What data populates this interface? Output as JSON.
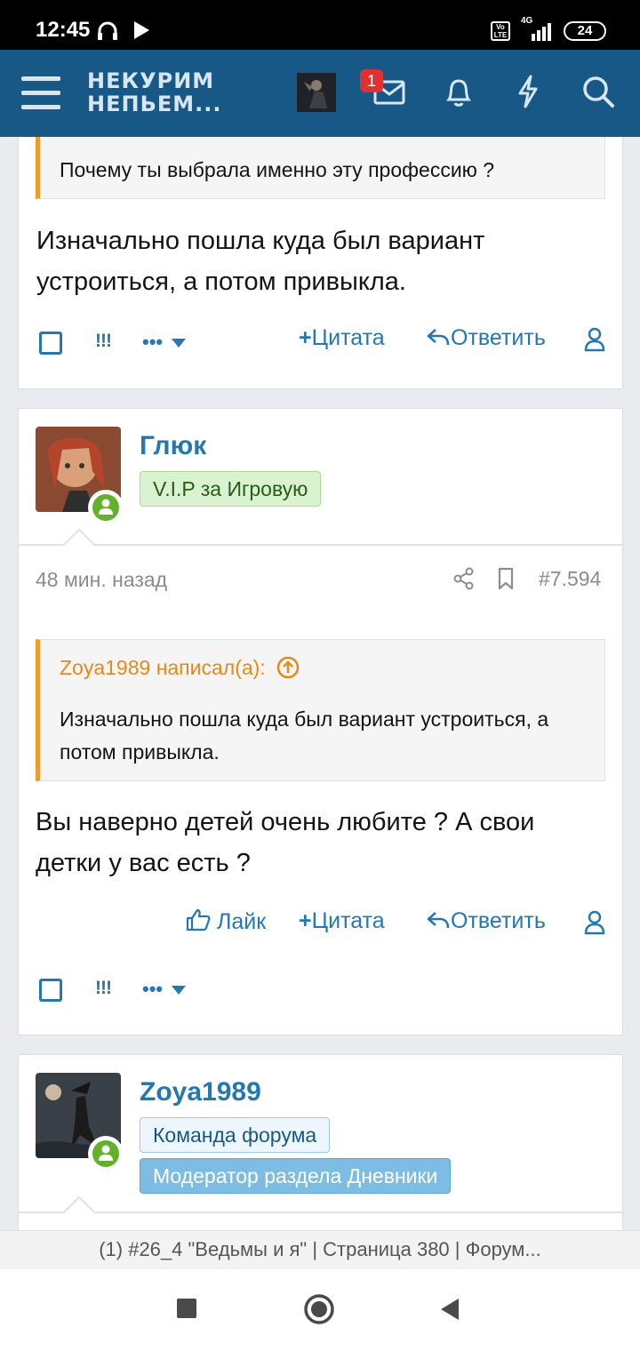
{
  "status_bar": {
    "time": "12:45",
    "battery": "24",
    "network": "4G",
    "volte": "Vo LTE"
  },
  "header": {
    "logo_line1": "НЕКУРИМ",
    "logo_line2": "НЕПЬЕМ...",
    "notification_count": "1",
    "accent_color": "#185886"
  },
  "post1": {
    "quote_text": "Почему ты выбрала именно эту профессию ?",
    "body": "Изначально пошла куда был вариант устроиться, а потом привыкла.",
    "actions": {
      "report": "!!!",
      "more": "•••",
      "quote": "Цитата",
      "reply": "Ответить"
    }
  },
  "post2": {
    "username": "Глюк",
    "title": "V.I.P за Игровую",
    "time": "48 мин. назад",
    "post_number": "#7.594",
    "quote_author": "Zoya1989 написал(а):",
    "quote_text": "Изначально пошла куда был вариант устроиться, а потом привыкла.",
    "body": "Вы наверно детей очень любите ? А свои детки у вас есть ?",
    "actions": {
      "like": "Лайк",
      "quote": "Цитата",
      "reply": "Ответить",
      "report": "!!!",
      "more": "•••"
    }
  },
  "post3": {
    "username": "Zoya1989",
    "tag1": "Команда форума",
    "tag2": "Модератор раздела Дневники"
  },
  "browser": {
    "tab_title": "(1) #26_4 \"Ведьмы и я\" | Страница 380 | Форум..."
  }
}
